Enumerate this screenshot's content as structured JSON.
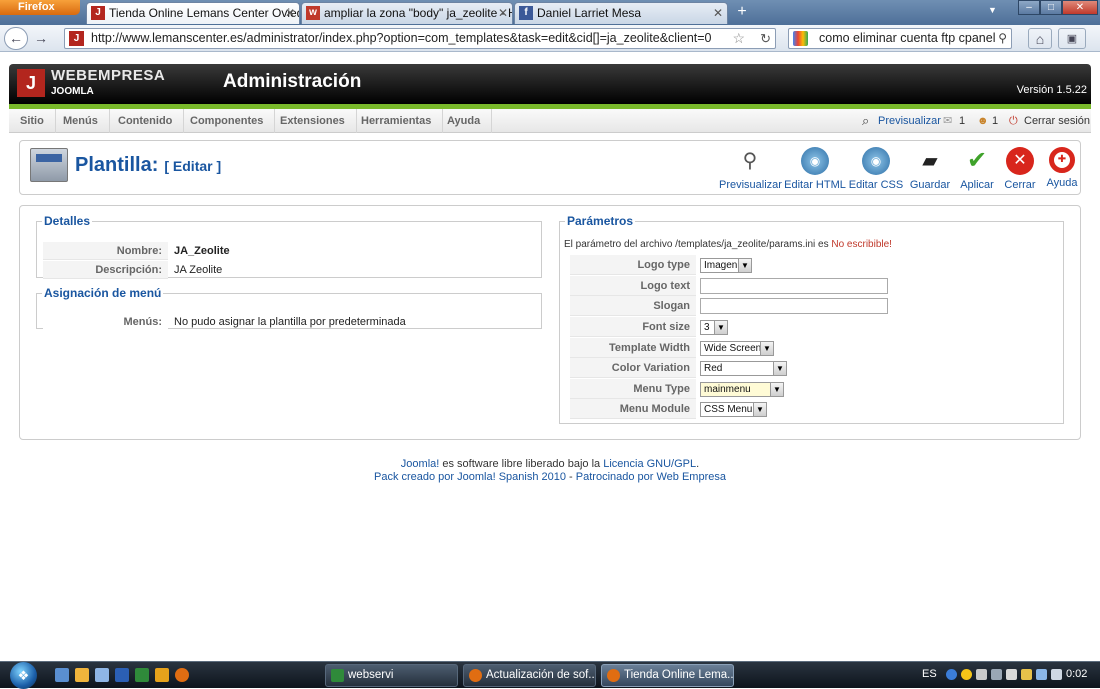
{
  "browser": {
    "menu_button": "Firefox",
    "tabs": [
      {
        "label": "Tienda Online Lemans Center Oviedo...",
        "active": true
      },
      {
        "label": "ampliar la zona \"body\" ja_zeolite - Ho...",
        "active": false
      },
      {
        "label": "Daniel Larriet Mesa",
        "active": false
      }
    ],
    "new_tab": "+",
    "url": "http://www.lemanscenter.es/administrator/index.php?option=com_templates&task=edit&cid[]=ja_zeolite&client=0",
    "search_value": "como eliminar cuenta ftp cpanel"
  },
  "header": {
    "brand": "WEBEMPRESA",
    "sub": "JOOMLA",
    "title": "Administración",
    "version": "Versión 1.5.22"
  },
  "menu": {
    "items": [
      "Sitio",
      "Menús",
      "Contenido",
      "Componentes",
      "Extensiones",
      "Herramientas",
      "Ayuda"
    ],
    "preview": "Previsualizar",
    "count1": "1",
    "count2": "1",
    "logout": "Cerrar sesión"
  },
  "toolbar": {
    "title": "Plantilla:",
    "subtitle": "[ Editar ]",
    "buttons": [
      "Previsualizar",
      "Editar HTML",
      "Editar CSS",
      "Guardar",
      "Aplicar",
      "Cerrar",
      "Ayuda"
    ]
  },
  "details": {
    "legend": "Detalles",
    "name_label": "Nombre:",
    "name_value": "JA_Zeolite",
    "desc_label": "Descripción:",
    "desc_value": "JA Zeolite"
  },
  "menu_assign": {
    "legend": "Asignación de menú",
    "label": "Menús:",
    "value": "No pudo asignar la plantilla por predeterminada"
  },
  "params": {
    "legend": "Parámetros",
    "notice": "El parámetro del archivo /templates/ja_zeolite/params.ini es",
    "notice_status": "No escribible!",
    "rows": [
      {
        "label": "Logo type",
        "value": "Imagen"
      },
      {
        "label": "Logo text",
        "value": ""
      },
      {
        "label": "Slogan",
        "value": ""
      },
      {
        "label": "Font size",
        "value": "3"
      },
      {
        "label": "Template Width",
        "value": "Wide Screen"
      },
      {
        "label": "Color Variation",
        "value": "Red"
      },
      {
        "label": "Menu Type",
        "value": "mainmenu"
      },
      {
        "label": "Menu Module",
        "value": "CSS Menu"
      }
    ]
  },
  "footer": {
    "line1_link1": "Joomla!",
    "line1_text": " es software libre liberado bajo la ",
    "line1_link2": "Licencia GNU/GPL",
    "line1_end": ".",
    "line2_link1": "Pack creado por Joomla! Spanish 2010",
    "line2_sep": " - ",
    "line2_link2": "Patrocinado por Web Empresa"
  },
  "taskbar": {
    "tasks": [
      "webservi",
      "Actualización de sof...",
      "Tienda Online Lema..."
    ],
    "lang": "ES",
    "clock": "0:02"
  }
}
